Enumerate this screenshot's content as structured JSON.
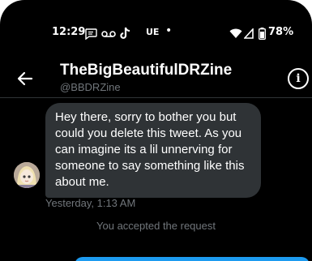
{
  "status_bar": {
    "time": "12:29",
    "carrier": "UE",
    "battery": "78%",
    "icons": [
      "message-icon",
      "voicemail-icon",
      "tiktok-icon",
      "wifi-icon",
      "signal-icon",
      "battery-icon"
    ]
  },
  "header": {
    "name": "TheBigBeautifulDRZine",
    "handle": "@BBDRZine",
    "icons": [
      "back-arrow-icon",
      "info-icon"
    ]
  },
  "conversation": {
    "message": "Hey there, sorry to bother you but could you delete this tweet. As you can imagine its a lil unnerving for someone to say something like this about me.",
    "timestamp": "Yesterday, 1:13 AM",
    "system_message": "You accepted the request"
  },
  "colors": {
    "background": "#000000",
    "bubble": "#2f3336",
    "muted_text": "#71767b",
    "accent": "#1d9bf0"
  }
}
